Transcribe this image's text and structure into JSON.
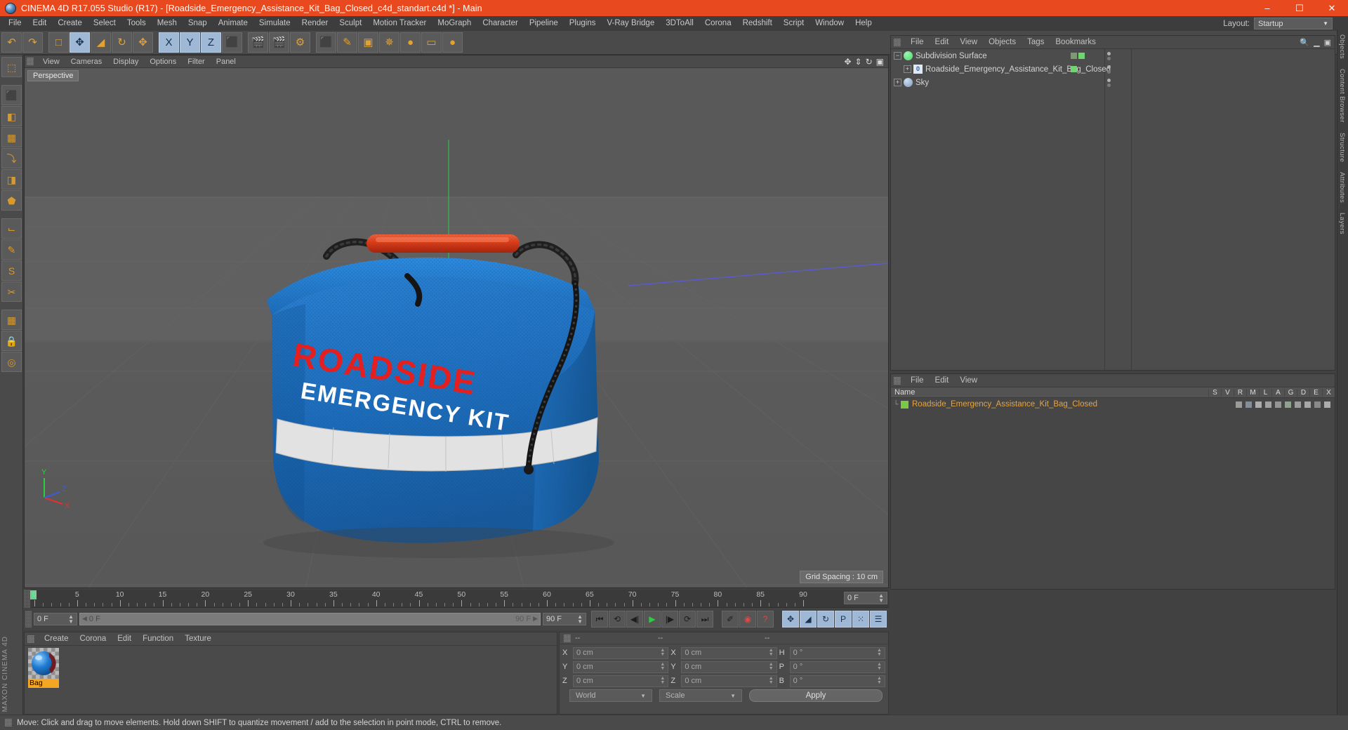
{
  "titlebar": {
    "title": "CINEMA 4D R17.055 Studio (R17) - [Roadside_Emergency_Assistance_Kit_Bag_Closed_c4d_standart.c4d *] - Main",
    "minimize": "–",
    "maximize": "☐",
    "close": "✕"
  },
  "menubar": {
    "items": [
      "File",
      "Edit",
      "Create",
      "Select",
      "Tools",
      "Mesh",
      "Snap",
      "Animate",
      "Simulate",
      "Render",
      "Sculpt",
      "Motion Tracker",
      "MoGraph",
      "Character",
      "Pipeline",
      "Plugins",
      "V-Ray Bridge",
      "3DToAll",
      "Corona",
      "Redshift",
      "Script",
      "Window",
      "Help"
    ]
  },
  "layout": {
    "label": "Layout:",
    "value": "Startup"
  },
  "toolbar": {
    "groups": [
      {
        "name": "undo",
        "buttons": [
          {
            "name": "undo-button",
            "glyph": "↶",
            "active": false
          },
          {
            "name": "redo-button",
            "glyph": "↷",
            "active": false
          }
        ]
      },
      {
        "name": "modes",
        "buttons": [
          {
            "name": "editable-object-button",
            "glyph": "□",
            "active": false
          },
          {
            "name": "move-tool-button",
            "glyph": "✥",
            "active": true
          },
          {
            "name": "scale-tool-button",
            "glyph": "◢",
            "active": false
          },
          {
            "name": "rotate-tool-button",
            "glyph": "↻",
            "active": false
          },
          {
            "name": "move-axis-button",
            "glyph": "✥",
            "active": false
          }
        ]
      },
      {
        "name": "axis-locks",
        "buttons": [
          {
            "name": "lock-x-axis-button",
            "glyph": "X",
            "active": true
          },
          {
            "name": "lock-y-axis-button",
            "glyph": "Y",
            "active": true
          },
          {
            "name": "lock-z-axis-button",
            "glyph": "Z",
            "active": true
          },
          {
            "name": "world-coordinate-button",
            "glyph": "⬛",
            "active": false
          }
        ]
      },
      {
        "name": "render",
        "buttons": [
          {
            "name": "render-view-button",
            "glyph": "🎬",
            "active": false
          },
          {
            "name": "render-to-picture-viewer-button",
            "glyph": "🎬",
            "active": false
          },
          {
            "name": "render-settings-button",
            "glyph": "⚙",
            "active": false
          }
        ]
      },
      {
        "name": "creation",
        "buttons": [
          {
            "name": "add-cube-button",
            "glyph": "⬛",
            "active": false
          },
          {
            "name": "add-spline-button",
            "glyph": "✎",
            "active": false
          },
          {
            "name": "add-generator-button",
            "glyph": "▣",
            "active": false
          },
          {
            "name": "add-deformer-button",
            "glyph": "✵",
            "active": false
          },
          {
            "name": "add-environment-button",
            "glyph": "●",
            "active": false
          },
          {
            "name": "add-camera-button",
            "glyph": "▭",
            "active": false
          },
          {
            "name": "add-light-button",
            "glyph": "●",
            "active": false
          }
        ]
      }
    ]
  },
  "left_palette": {
    "buttons": [
      {
        "name": "live-selection-tool",
        "glyph": "⬚"
      },
      {
        "name": "box-object-tool",
        "glyph": "⬛"
      },
      {
        "name": "array-tool",
        "glyph": "◧"
      },
      {
        "name": "subdivision-tool",
        "glyph": "▦"
      },
      {
        "name": "bend-deformer-tool",
        "glyph": "⤵"
      },
      {
        "name": "extrude-tool",
        "glyph": "◨"
      },
      {
        "name": "mesh-tool",
        "glyph": "⬟"
      },
      {
        "name": "measure-tool",
        "glyph": "⌙"
      },
      {
        "name": "paint-tool",
        "glyph": "✎"
      },
      {
        "name": "sculpt-tool",
        "glyph": "S"
      },
      {
        "name": "knife-tool",
        "glyph": "✂"
      },
      {
        "name": "uv-tool",
        "glyph": "▦"
      },
      {
        "name": "lock-tool",
        "glyph": "🔒"
      },
      {
        "name": "snap-tool",
        "glyph": "◎"
      }
    ]
  },
  "right_tabs": [
    "Objects",
    "Content Browser",
    "Structure",
    "Attributes",
    "Layers"
  ],
  "viewport": {
    "menu": [
      "View",
      "Cameras",
      "Display",
      "Options",
      "Filter",
      "Panel"
    ],
    "camera_tag": "Perspective",
    "grid_spacing": "Grid Spacing : 10 cm",
    "axis_labels": {
      "x": "X",
      "y": "Y",
      "z": "Z"
    },
    "bag": {
      "title_line1": "ROADSIDE",
      "title_line2": "EMERGENCY KIT",
      "body_color": "#1a6fc4",
      "text_color": "#e02020",
      "handle_color": "#e23a12",
      "stripe_color": "#e3e3e3"
    },
    "nav_icons": [
      "move-view-icon",
      "zoom-view-icon",
      "rotate-view-icon",
      "maximize-view-icon"
    ]
  },
  "object_manager": {
    "menu": [
      "File",
      "Edit",
      "View",
      "Objects",
      "Tags",
      "Bookmarks"
    ],
    "items": [
      {
        "label": "Subdivision Surface",
        "depth": 0,
        "icon_color": "#4cd964",
        "type": "generator",
        "dot_left": "#7d9b6e",
        "dot_right": "#6fd56f",
        "expanded": true
      },
      {
        "label": "Roadside_Emergency_Assistance_Kit_Bag_Closed",
        "depth": 1,
        "icon_color": "#dfe9f5",
        "type": "polygon",
        "dot_left": "#6fd56f",
        "dot_right": "",
        "expanded": false
      },
      {
        "label": "Sky",
        "depth": 0,
        "icon_color": "#9fb6cf",
        "type": "sky",
        "dot_left": "",
        "dot_right": "",
        "expanded": false
      }
    ]
  },
  "layer_panel": {
    "menu": [
      "File",
      "Edit",
      "View"
    ],
    "columns": [
      "Name",
      "S",
      "V",
      "R",
      "M",
      "L",
      "A",
      "G",
      "D",
      "E",
      "X"
    ],
    "rows": [
      {
        "name": "Roadside_Emergency_Assistance_Kit_Bag_Closed",
        "color": "#7ac943"
      }
    ]
  },
  "timeline": {
    "start_frame": "0 F",
    "end_frame": "90 F",
    "current_frame": "0 F",
    "preview_end": "90 F",
    "field_right": "0 F",
    "ticks": [
      0,
      5,
      10,
      15,
      20,
      25,
      30,
      35,
      40,
      45,
      50,
      55,
      60,
      65,
      70,
      75,
      80,
      85,
      90
    ],
    "transport": [
      {
        "name": "go-to-start-button",
        "glyph": "⏮"
      },
      {
        "name": "previous-keyframe-button",
        "glyph": "⟲"
      },
      {
        "name": "previous-frame-button",
        "glyph": "◀|"
      },
      {
        "name": "play-button",
        "glyph": "▶"
      },
      {
        "name": "next-frame-button",
        "glyph": "|▶"
      },
      {
        "name": "next-keyframe-button",
        "glyph": "⟳"
      },
      {
        "name": "go-to-end-button",
        "glyph": "⏭"
      }
    ],
    "record_tools": [
      {
        "name": "autokey-button",
        "glyph": "✐"
      },
      {
        "name": "record-active-objects-button",
        "glyph": "◉"
      },
      {
        "name": "keyframe-selection-button",
        "glyph": "?"
      }
    ],
    "key_filters": [
      {
        "name": "position-key-button",
        "glyph": "✥"
      },
      {
        "name": "scale-key-button",
        "glyph": "◢"
      },
      {
        "name": "rotation-key-button",
        "glyph": "↻"
      },
      {
        "name": "parameter-key-button",
        "glyph": "P"
      },
      {
        "name": "point-level-animation-button",
        "glyph": "⁙"
      },
      {
        "name": "timeline-toggle-button",
        "glyph": "☰"
      }
    ]
  },
  "material_manager": {
    "menu": [
      "Create",
      "Corona",
      "Edit",
      "Function",
      "Texture"
    ],
    "materials": [
      {
        "name": "Bag",
        "color": "#1f7ad1"
      }
    ]
  },
  "coordinates": {
    "header": [
      "--",
      "--",
      "--"
    ],
    "rows": [
      {
        "pos_label": "X",
        "pos_value": "0 cm",
        "size_label": "X",
        "size_value": "0 cm",
        "rot_label": "H",
        "rot_value": "0 °"
      },
      {
        "pos_label": "Y",
        "pos_value": "0 cm",
        "size_label": "Y",
        "size_value": "0 cm",
        "rot_label": "P",
        "rot_value": "0 °"
      },
      {
        "pos_label": "Z",
        "pos_value": "0 cm",
        "size_label": "Z",
        "size_value": "0 cm",
        "rot_label": "B",
        "rot_value": "0 °"
      }
    ],
    "coord_system": "World",
    "transform_mode": "Scale",
    "apply_label": "Apply"
  },
  "statusbar": {
    "text": "Move: Click and drag to move elements. Hold down SHIFT to quantize movement / add to the selection in point mode, CTRL to remove."
  },
  "branding": "MAXON CINEMA 4D"
}
